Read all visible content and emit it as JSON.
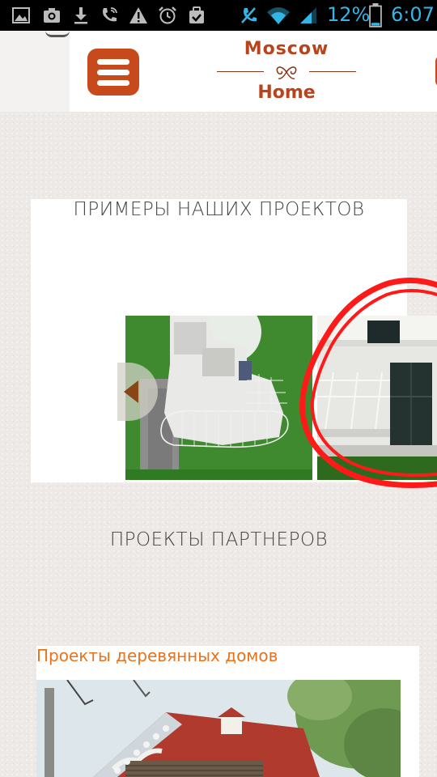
{
  "status_bar": {
    "battery_percent": "12%",
    "time": "6:07",
    "icons": [
      "image-icon",
      "camera-icon",
      "download-icon",
      "call-icon",
      "warning-icon",
      "alarm-icon",
      "clipboard-check-icon",
      "mute-icon",
      "wifi-icon",
      "signal-icon",
      "battery-icon"
    ],
    "accent_color": "#33b5e5"
  },
  "header": {
    "logo_top": "Moscow",
    "logo_bottom": "Home",
    "brand_color": "#c74a1c"
  },
  "projects": {
    "heading": "ПРИМЕРЫ НАШИХ ПРОЕКТОВ"
  },
  "partners": {
    "heading": "ПРОЕКТЫ ПАРТНЕРОВ"
  },
  "wooden_houses": {
    "title": "Проекты деревянных домов",
    "title_color": "#e8731c"
  }
}
